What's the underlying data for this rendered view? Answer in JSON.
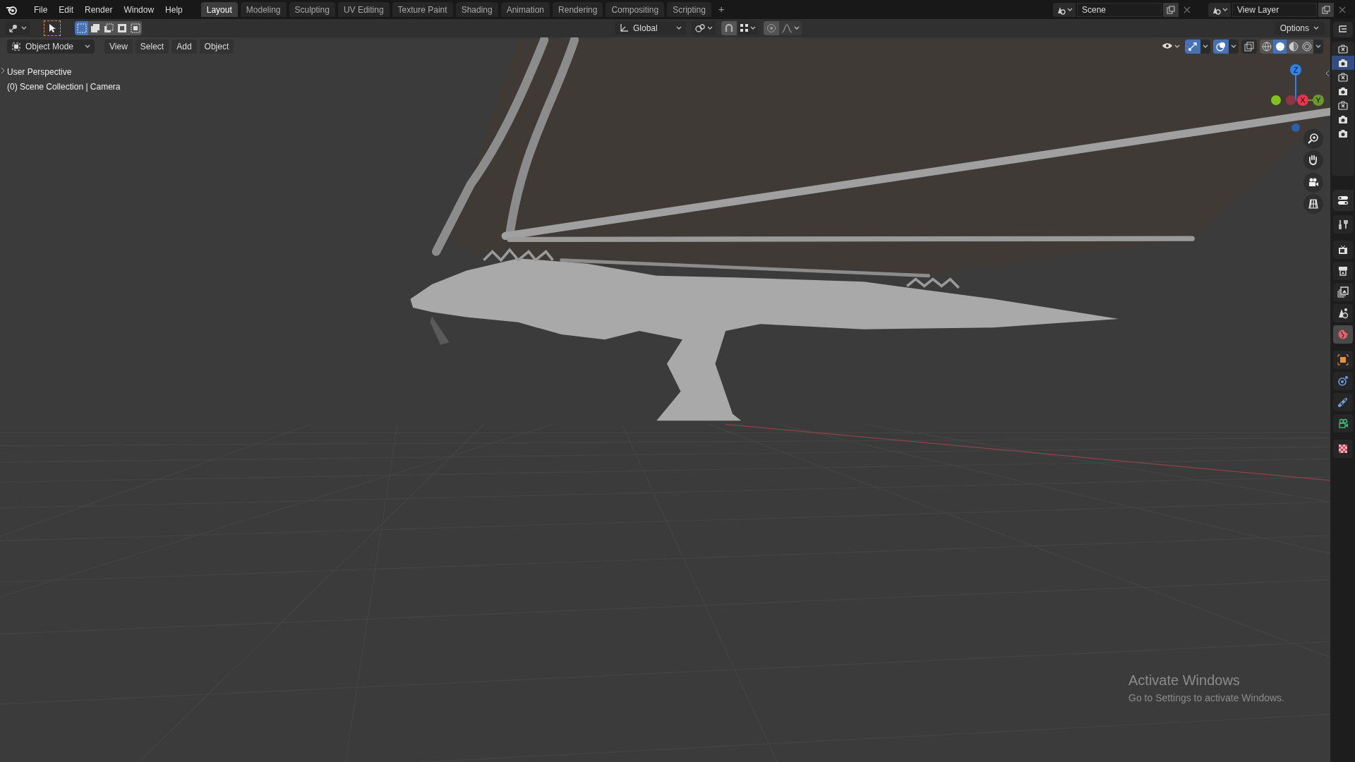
{
  "menu": [
    "File",
    "Edit",
    "Render",
    "Window",
    "Help"
  ],
  "workspaces": [
    {
      "label": "Layout",
      "selected": true
    },
    {
      "label": "Modeling",
      "selected": false
    },
    {
      "label": "Sculpting",
      "selected": false
    },
    {
      "label": "UV Editing",
      "selected": false
    },
    {
      "label": "Texture Paint",
      "selected": false
    },
    {
      "label": "Shading",
      "selected": false
    },
    {
      "label": "Animation",
      "selected": false
    },
    {
      "label": "Rendering",
      "selected": false
    },
    {
      "label": "Compositing",
      "selected": false
    },
    {
      "label": "Scripting",
      "selected": false
    }
  ],
  "add_workspace": "+",
  "scene": {
    "name": "Scene"
  },
  "view_layer": {
    "name": "View Layer"
  },
  "tool_header": {
    "select_modes": [
      {
        "kind": "new",
        "selected": true
      },
      {
        "kind": "extend",
        "selected": false
      },
      {
        "kind": "subtract",
        "selected": false
      },
      {
        "kind": "invert",
        "selected": false
      },
      {
        "kind": "intersect",
        "selected": false
      }
    ],
    "orientation": "Global",
    "options": "Options"
  },
  "viewport": {
    "mode": "Object Mode",
    "menus": [
      "View",
      "Select",
      "Add",
      "Object"
    ],
    "shading": [
      {
        "kind": "wireframe",
        "selected": false
      },
      {
        "kind": "solid",
        "selected": true
      },
      {
        "kind": "material",
        "selected": false
      },
      {
        "kind": "rendered",
        "selected": false
      }
    ],
    "info": [
      "User Perspective",
      "(0) Scene Collection | Camera"
    ],
    "gizmo": {
      "z": "Z",
      "x": "X",
      "y": "Y"
    }
  },
  "outliner_filters": [
    {
      "excluded": true,
      "selected": false
    },
    {
      "excluded": false,
      "selected": true
    },
    {
      "excluded": true,
      "selected": false
    },
    {
      "excluded": false,
      "selected": false
    },
    {
      "excluded": true,
      "selected": false
    },
    {
      "excluded": false,
      "selected": false
    },
    {
      "excluded": false,
      "selected": false
    }
  ],
  "properties_tabs": [
    {
      "kind": "tool",
      "selected": false
    },
    {
      "kind": "render",
      "selected": false
    },
    {
      "kind": "output",
      "selected": false
    },
    {
      "kind": "view_layer",
      "selected": false
    },
    {
      "kind": "scene",
      "selected": false
    },
    {
      "kind": "world",
      "selected": true
    },
    {
      "kind": "object",
      "selected": false
    },
    {
      "kind": "physics",
      "selected": false
    },
    {
      "kind": "constraints",
      "selected": false
    },
    {
      "kind": "camera_data",
      "selected": false
    },
    {
      "kind": "texture",
      "selected": false
    }
  ],
  "watermark": {
    "title": "Activate Windows",
    "text": "Go to Settings to activate Windows."
  }
}
